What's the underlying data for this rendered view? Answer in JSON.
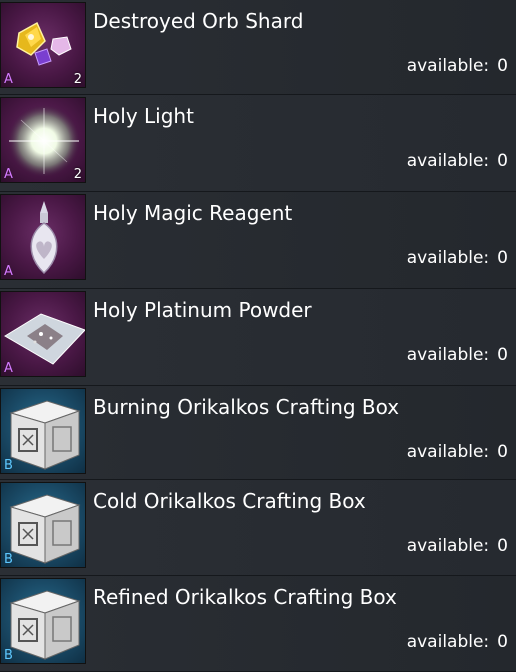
{
  "available_label": "available:",
  "items": [
    {
      "name": "Destroyed Orb Shard",
      "grade": "A",
      "quantity": "2",
      "available": "0",
      "icon": "orb-shard-icon"
    },
    {
      "name": "Holy Light",
      "grade": "A",
      "quantity": "2",
      "available": "0",
      "icon": "holy-light-icon"
    },
    {
      "name": "Holy Magic Reagent",
      "grade": "A",
      "quantity": "",
      "available": "0",
      "icon": "reagent-vial-icon"
    },
    {
      "name": "Holy Platinum Powder",
      "grade": "A",
      "quantity": "",
      "available": "0",
      "icon": "platinum-powder-icon"
    },
    {
      "name": "Burning Orikalkos Crafting Box",
      "grade": "B",
      "quantity": "",
      "available": "0",
      "icon": "crafting-box-icon"
    },
    {
      "name": "Cold Orikalkos Crafting Box",
      "grade": "B",
      "quantity": "",
      "available": "0",
      "icon": "crafting-box-icon"
    },
    {
      "name": "Refined Orikalkos Crafting Box",
      "grade": "B",
      "quantity": "",
      "available": "0",
      "icon": "crafting-box-icon"
    }
  ],
  "colors": {
    "grade_a": "#d37bff",
    "grade_b": "#5ec8ff",
    "row_background": "#282c32"
  }
}
